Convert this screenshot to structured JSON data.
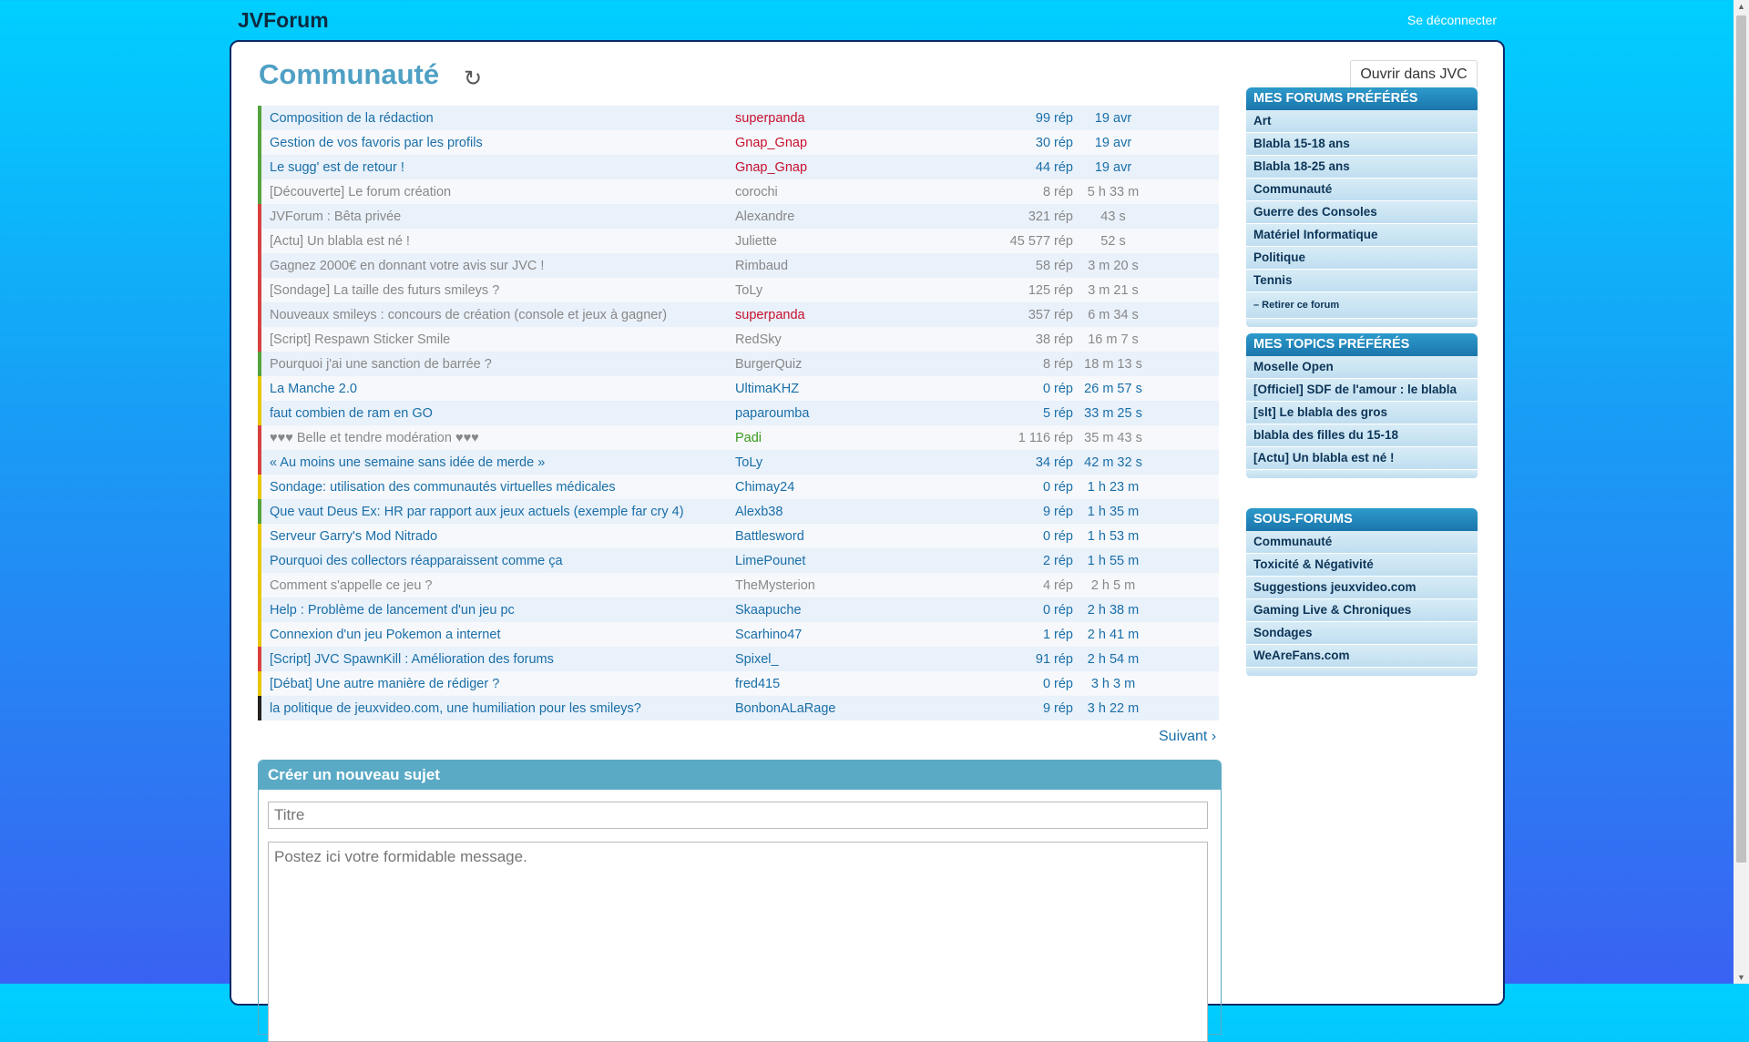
{
  "header": {
    "brand": "JVForum",
    "logout": "Se déconnecter"
  },
  "page": {
    "title": "Communauté",
    "refresh_icon": "↻",
    "open_jvc": "Ouvrir dans JVC"
  },
  "topics": [
    {
      "title": "Composition de la rédaction",
      "author": "superpanda",
      "replies": "99 rép",
      "date": "19 avr",
      "flag": "g",
      "muted": false,
      "author_style": "admin"
    },
    {
      "title": "Gestion de vos favoris par les profils",
      "author": "Gnap_Gnap",
      "replies": "30 rép",
      "date": "19 avr",
      "flag": "g",
      "muted": false,
      "author_style": "admin"
    },
    {
      "title": "Le sugg' est de retour !",
      "author": "Gnap_Gnap",
      "replies": "44 rép",
      "date": "19 avr",
      "flag": "g",
      "muted": false,
      "author_style": "admin"
    },
    {
      "title": "[Découverte] Le forum création",
      "author": "corochi",
      "replies": "8 rép",
      "date": "5 h 33 m",
      "flag": "g",
      "muted": true,
      "author_style": ""
    },
    {
      "title": "JVForum : Bêta privée",
      "author": "Alexandre",
      "replies": "321 rép",
      "date": "43 s",
      "flag": "r",
      "muted": true,
      "author_style": ""
    },
    {
      "title": "[Actu] Un blabla est né !",
      "author": "Juliette",
      "replies": "45 577 rép",
      "date": "52 s",
      "flag": "r",
      "muted": true,
      "author_style": ""
    },
    {
      "title": "Gagnez 2000€ en donnant votre avis sur JVC !",
      "author": "Rimbaud",
      "replies": "58 rép",
      "date": "3 m 20 s",
      "flag": "r",
      "muted": true,
      "author_style": ""
    },
    {
      "title": "[Sondage] La taille des futurs smileys ?",
      "author": "ToLy",
      "replies": "125 rép",
      "date": "3 m 21 s",
      "flag": "r",
      "muted": true,
      "author_style": ""
    },
    {
      "title": "Nouveaux smileys : concours de création (console et jeux à gagner)",
      "author": "superpanda",
      "replies": "357 rép",
      "date": "6 m 34 s",
      "flag": "r",
      "muted": true,
      "author_style": "admin"
    },
    {
      "title": "[Script] Respawn Sticker Smile",
      "author": "RedSky",
      "replies": "38 rép",
      "date": "16 m 7 s",
      "flag": "r",
      "muted": true,
      "author_style": ""
    },
    {
      "title": "Pourquoi j'ai une sanction de barrée ?",
      "author": "BurgerQuiz",
      "replies": "8 rép",
      "date": "18 m 13 s",
      "flag": "g",
      "muted": true,
      "author_style": ""
    },
    {
      "title": "La Manche 2.0",
      "author": "UltimaKHZ",
      "replies": "0 rép",
      "date": "26 m 57 s",
      "flag": "y",
      "muted": false,
      "author_style": ""
    },
    {
      "title": "faut combien de ram en GO",
      "author": "paparoumba",
      "replies": "5 rép",
      "date": "33 m 25 s",
      "flag": "y",
      "muted": false,
      "author_style": ""
    },
    {
      "title": "♥♥♥ Belle et tendre modération ♥♥♥",
      "author": "Padi",
      "replies": "1 116 rép",
      "date": "35 m 43 s",
      "flag": "r",
      "muted": true,
      "author_style": "green"
    },
    {
      "title": "« Au moins une semaine sans idée de merde »",
      "author": "ToLy",
      "replies": "34 rép",
      "date": "42 m 32 s",
      "flag": "r",
      "muted": false,
      "author_style": ""
    },
    {
      "title": "Sondage: utilisation des communautés virtuelles médicales",
      "author": "Chimay24",
      "replies": "0 rép",
      "date": "1 h 23 m",
      "flag": "y",
      "muted": false,
      "author_style": ""
    },
    {
      "title": "Que vaut Deus Ex: HR par rapport aux jeux actuels (exemple far cry 4)",
      "author": "Alexb38",
      "replies": "9 rép",
      "date": "1 h 35 m",
      "flag": "g",
      "muted": false,
      "author_style": ""
    },
    {
      "title": "Serveur Garry's Mod Nitrado",
      "author": "Battlesword",
      "replies": "0 rép",
      "date": "1 h 53 m",
      "flag": "y",
      "muted": false,
      "author_style": ""
    },
    {
      "title": "Pourquoi des collectors réapparaissent comme ça",
      "author": "LimePounet",
      "replies": "2 rép",
      "date": "1 h 55 m",
      "flag": "y",
      "muted": false,
      "author_style": ""
    },
    {
      "title": "Comment s'appelle ce jeu ?",
      "author": "TheMysterion",
      "replies": "4 rép",
      "date": "2 h 5 m",
      "flag": "y",
      "muted": true,
      "author_style": ""
    },
    {
      "title": "Help : Problème de lancement d'un jeu pc",
      "author": "Skaapuche",
      "replies": "0 rép",
      "date": "2 h 38 m",
      "flag": "y",
      "muted": false,
      "author_style": ""
    },
    {
      "title": "Connexion d'un jeu Pokemon a internet",
      "author": "Scarhino47",
      "replies": "1 rép",
      "date": "2 h 41 m",
      "flag": "y",
      "muted": false,
      "author_style": ""
    },
    {
      "title": "[Script] JVC SpawnKill : Amélioration des forums",
      "author": "Spixel_",
      "replies": "91 rép",
      "date": "2 h 54 m",
      "flag": "r",
      "muted": false,
      "author_style": ""
    },
    {
      "title": "[Débat] Une autre manière de rédiger ?",
      "author": "fred415",
      "replies": "0 rép",
      "date": "3 h 3 m",
      "flag": "y",
      "muted": false,
      "author_style": ""
    },
    {
      "title": "la politique de jeuxvideo.com, une humiliation pour les smileys?",
      "author": "BonbonALaRage",
      "replies": "9 rép",
      "date": "3 h 22 m",
      "flag": "k",
      "muted": false,
      "author_style": ""
    }
  ],
  "pagination": {
    "next": "Suivant",
    "next_icon": "chevron-right"
  },
  "new_topic": {
    "heading": "Créer un nouveau sujet",
    "title_placeholder": "Titre",
    "message_placeholder": "Postez ici votre formidable message."
  },
  "sidebar": {
    "favorite_forums": {
      "heading": "MES FORUMS PRÉFÉRÉS",
      "items": [
        "Art",
        "Blabla 15-18 ans",
        "Blabla 18-25 ans",
        "Communauté",
        "Guerre des Consoles",
        "Matériel Informatique",
        "Politique",
        "Tennis"
      ],
      "remove": "– Retirer ce forum"
    },
    "favorite_topics": {
      "heading": "MES TOPICS PRÉFÉRÉS",
      "items": [
        "Moselle Open",
        "[Officiel] SDF de l'amour : le blabla",
        "[slt] Le blabla des gros",
        "blabla des filles du 15-18",
        "[Actu] Un blabla est né !"
      ]
    },
    "subforums": {
      "heading": "SOUS-FORUMS",
      "items": [
        "Communauté",
        "Toxicité & Négativité",
        "Suggestions jeuxvideo.com",
        "Gaming Live & Chroniques",
        "Sondages",
        "WeAreFans.com"
      ]
    }
  },
  "colors": {
    "accent": "#4fa0c4",
    "link": "#1a6fa8",
    "admin": "#c8102e",
    "moderator": "#3a9b1c"
  }
}
